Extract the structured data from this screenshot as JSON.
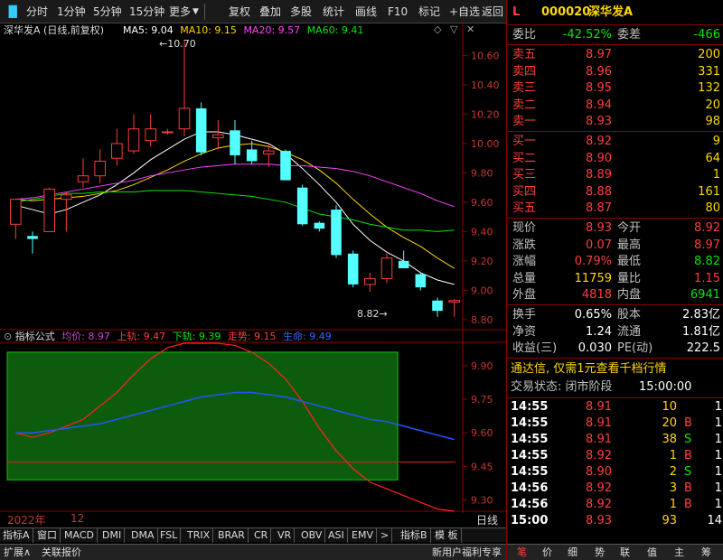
{
  "toolbar": {
    "items": [
      "分时",
      "1分钟",
      "5分钟",
      "15分钟",
      "更多",
      "复权",
      "叠加",
      "多股",
      "统计",
      "画线",
      "F10",
      "标记",
      "+自选",
      "返回"
    ]
  },
  "chart": {
    "title": "深华发A (日线,前复权)",
    "ma": [
      {
        "label": "MA5: 9.04",
        "color": "#ffffff"
      },
      {
        "label": "MA10: 9.15",
        "color": "#ffd700"
      },
      {
        "label": "MA20: 9.57",
        "color": "#ff44ff"
      },
      {
        "label": "MA60: 9.41",
        "color": "#00e600"
      }
    ],
    "high_label": "10.70",
    "low_label": "8.82",
    "yticks": [
      "10.60",
      "10.40",
      "10.20",
      "10.00",
      "9.80",
      "9.60",
      "9.40",
      "9.20",
      "9.00",
      "8.80"
    ],
    "ymin": 8.75,
    "ymax": 10.72,
    "candles": [
      {
        "o": 9.45,
        "h": 9.62,
        "l": 9.35,
        "c": 9.62
      },
      {
        "o": 9.37,
        "h": 9.4,
        "l": 9.25,
        "c": 9.35
      },
      {
        "o": 9.4,
        "h": 9.7,
        "l": 9.4,
        "c": 9.69
      },
      {
        "o": 9.62,
        "h": 9.67,
        "l": 9.4,
        "c": 9.65
      },
      {
        "o": 9.74,
        "h": 9.9,
        "l": 9.7,
        "c": 9.78
      },
      {
        "o": 9.78,
        "h": 9.96,
        "l": 9.73,
        "c": 9.88
      },
      {
        "o": 9.9,
        "h": 10.1,
        "l": 9.85,
        "c": 10.0
      },
      {
        "o": 9.95,
        "h": 10.2,
        "l": 9.93,
        "c": 10.1
      },
      {
        "o": 10.02,
        "h": 10.2,
        "l": 9.98,
        "c": 10.1
      },
      {
        "o": 10.08,
        "h": 10.1,
        "l": 10.06,
        "c": 10.08
      },
      {
        "o": 10.1,
        "h": 10.7,
        "l": 10.05,
        "c": 10.24
      },
      {
        "o": 10.24,
        "h": 10.28,
        "l": 9.92,
        "c": 9.94
      },
      {
        "o": 10.04,
        "h": 10.16,
        "l": 9.96,
        "c": 10.06
      },
      {
        "o": 10.09,
        "h": 10.16,
        "l": 9.86,
        "c": 9.92
      },
      {
        "o": 9.96,
        "h": 10.02,
        "l": 9.86,
        "c": 9.88
      },
      {
        "o": 9.93,
        "h": 10.0,
        "l": 9.84,
        "c": 9.95
      },
      {
        "o": 9.95,
        "h": 9.96,
        "l": 9.75,
        "c": 9.75
      },
      {
        "o": 9.7,
        "h": 9.72,
        "l": 9.44,
        "c": 9.45
      },
      {
        "o": 9.46,
        "h": 9.47,
        "l": 9.4,
        "c": 9.42
      },
      {
        "o": 9.55,
        "h": 9.58,
        "l": 9.22,
        "c": 9.24
      },
      {
        "o": 9.25,
        "h": 9.27,
        "l": 9.02,
        "c": 9.04
      },
      {
        "o": 9.04,
        "h": 9.12,
        "l": 8.99,
        "c": 9.08
      },
      {
        "o": 9.08,
        "h": 9.25,
        "l": 9.05,
        "c": 9.22
      },
      {
        "o": 9.2,
        "h": 9.27,
        "l": 9.15,
        "c": 9.15
      },
      {
        "o": 9.11,
        "h": 9.12,
        "l": 9.0,
        "c": 9.02
      },
      {
        "o": 8.93,
        "h": 8.95,
        "l": 8.82,
        "c": 8.86
      },
      {
        "o": 8.92,
        "h": 8.94,
        "l": 8.82,
        "c": 8.93
      }
    ],
    "ma_series": {
      "ma5": [
        9.58,
        9.55,
        9.52,
        9.55,
        9.6,
        9.65,
        9.72,
        9.8,
        9.89,
        9.96,
        10.03,
        10.08,
        10.08,
        10.06,
        10.03,
        10.0,
        9.93,
        9.83,
        9.72,
        9.6,
        9.45,
        9.34,
        9.26,
        9.2,
        9.12,
        9.07,
        9.04
      ],
      "ma10": [
        9.62,
        9.61,
        9.62,
        9.63,
        9.64,
        9.66,
        9.68,
        9.72,
        9.77,
        9.82,
        9.88,
        9.93,
        9.97,
        9.99,
        10.0,
        9.98,
        9.94,
        9.89,
        9.82,
        9.73,
        9.62,
        9.52,
        9.43,
        9.36,
        9.3,
        9.22,
        9.15
      ],
      "ma20": [
        9.62,
        9.63,
        9.65,
        9.67,
        9.69,
        9.71,
        9.73,
        9.75,
        9.78,
        9.8,
        9.82,
        9.84,
        9.85,
        9.86,
        9.86,
        9.86,
        9.85,
        9.85,
        9.84,
        9.83,
        9.81,
        9.78,
        9.74,
        9.7,
        9.66,
        9.61,
        9.57
      ],
      "ma60": [
        9.6,
        9.62,
        9.64,
        9.66,
        9.66,
        9.67,
        9.67,
        9.67,
        9.68,
        9.68,
        9.68,
        9.67,
        9.66,
        9.65,
        9.64,
        9.62,
        9.6,
        9.56,
        9.52,
        9.5,
        9.48,
        9.45,
        9.43,
        9.41,
        9.41,
        9.4,
        9.41
      ]
    }
  },
  "indicator": {
    "name": "指标公式",
    "lines": [
      {
        "label": "均价: 8.97",
        "color": "#cc44cc"
      },
      {
        "label": "上轨: 9.47",
        "color": "#ff3c3c"
      },
      {
        "label": "下轨: 9.39",
        "color": "#00e600"
      },
      {
        "label": "走势: 9.15",
        "color": "#ff3c3c"
      },
      {
        "label": "生命: 9.49",
        "color": "#3366ff"
      }
    ],
    "yticks": [
      "9.90",
      "9.75",
      "9.60",
      "9.45",
      "9.30"
    ],
    "ymin": 9.25,
    "ymax": 10.0,
    "band_top": 9.96,
    "band_bot": 9.39,
    "red_line": [
      9.6,
      9.58,
      9.6,
      9.63,
      9.66,
      9.72,
      9.78,
      9.86,
      9.93,
      9.98,
      10.0,
      10.0,
      10.0,
      9.99,
      9.96,
      9.91,
      9.84,
      9.74,
      9.62,
      9.52,
      9.44,
      9.38,
      9.35,
      9.32,
      9.29,
      9.26,
      9.25
    ],
    "blue_line": [
      9.6,
      9.6,
      9.61,
      9.62,
      9.63,
      9.64,
      9.66,
      9.68,
      9.7,
      9.72,
      9.74,
      9.76,
      9.77,
      9.78,
      9.78,
      9.77,
      9.76,
      9.74,
      9.72,
      9.7,
      9.68,
      9.66,
      9.65,
      9.63,
      9.61,
      9.59,
      9.57
    ]
  },
  "axis": {
    "year": "2022年",
    "month": "12",
    "period": "日线"
  },
  "bottom_tabs": [
    "指标A",
    "窗口",
    "MACD",
    "DMI",
    "DMA",
    "FSL",
    "TRIX",
    "BRAR",
    "CR",
    "VR",
    "OBV",
    "ASI",
    "EMV",
    ">",
    "指标B",
    "模 板"
  ],
  "status_bar": {
    "left": [
      "扩展∧",
      "关联报价"
    ],
    "right": "新用户福利专享",
    "tabs": [
      "笔",
      "价",
      "细",
      "势",
      "联",
      "值",
      "主",
      "筹"
    ]
  },
  "quote": {
    "code": "000020",
    "name": "深华发A",
    "weibi": {
      "label": "委比",
      "value": "-42.52%",
      "label2": "委差",
      "value2": "-466"
    },
    "asks": [
      {
        "label": "卖五",
        "price": "8.97",
        "vol": "200"
      },
      {
        "label": "卖四",
        "price": "8.96",
        "vol": "331"
      },
      {
        "label": "卖三",
        "price": "8.95",
        "vol": "132"
      },
      {
        "label": "卖二",
        "price": "8.94",
        "vol": "20"
      },
      {
        "label": "卖一",
        "price": "8.93",
        "vol": "98"
      }
    ],
    "bids": [
      {
        "label": "买一",
        "price": "8.92",
        "vol": "9"
      },
      {
        "label": "买二",
        "price": "8.90",
        "vol": "64"
      },
      {
        "label": "买三",
        "price": "8.89",
        "vol": "1"
      },
      {
        "label": "买四",
        "price": "8.88",
        "vol": "161"
      },
      {
        "label": "买五",
        "price": "8.87",
        "vol": "80"
      }
    ],
    "stats": [
      {
        "l1": "现价",
        "v1": "8.93",
        "c1": "red",
        "l2": "今开",
        "v2": "8.92",
        "c2": "red"
      },
      {
        "l1": "涨跌",
        "v1": "0.07",
        "c1": "red",
        "l2": "最高",
        "v2": "8.97",
        "c2": "red"
      },
      {
        "l1": "涨幅",
        "v1": "0.79%",
        "c1": "red",
        "l2": "最低",
        "v2": "8.82",
        "c2": "green"
      },
      {
        "l1": "总量",
        "v1": "11759",
        "c1": "yellow",
        "l2": "量比",
        "v2": "1.15",
        "c2": "red"
      },
      {
        "l1": "外盘",
        "v1": "4818",
        "c1": "red",
        "l2": "内盘",
        "v2": "6941",
        "c2": "green"
      }
    ],
    "stats2": [
      {
        "l1": "换手",
        "v1": "0.65%",
        "l2": "股本",
        "v2": "2.83亿"
      },
      {
        "l1": "净资",
        "v1": "1.24",
        "l2": "流通",
        "v2": "1.81亿"
      },
      {
        "l1": "收益(三)",
        "v1": "0.030",
        "l2": "PE(动)",
        "v2": "222.5"
      }
    ],
    "promo": "通达信, 仅需1元查看千档行情",
    "trade_status_label": "交易状态: 闭市阶段",
    "trade_status_time": "15:00:00",
    "ticks": [
      {
        "t": "14:55",
        "p": "8.91",
        "v": "10",
        "s": ""
      },
      {
        "t": "14:55",
        "p": "8.91",
        "v": "20",
        "s": "B"
      },
      {
        "t": "14:55",
        "p": "8.91",
        "v": "38",
        "s": "S"
      },
      {
        "t": "14:55",
        "p": "8.92",
        "v": "1",
        "s": "B"
      },
      {
        "t": "14:55",
        "p": "8.90",
        "v": "2",
        "s": "S"
      },
      {
        "t": "14:56",
        "p": "8.92",
        "v": "3",
        "s": "B"
      },
      {
        "t": "14:56",
        "p": "8.92",
        "v": "1",
        "s": "B"
      },
      {
        "t": "15:00",
        "p": "8.93",
        "v": "93",
        "s": ""
      }
    ],
    "tick_suffix": [
      "1",
      "1",
      "1",
      "1",
      "1",
      "1",
      "1",
      "14"
    ]
  }
}
